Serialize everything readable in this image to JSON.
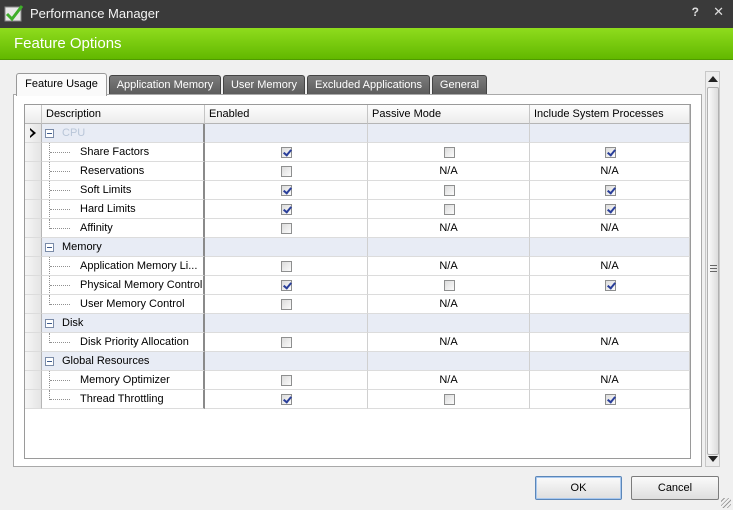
{
  "window": {
    "title": "Performance Manager",
    "help_glyph": "?",
    "close_glyph": "✕"
  },
  "banner": {
    "title": "Feature Options"
  },
  "tabs": [
    {
      "label": "Feature Usage",
      "active": true
    },
    {
      "label": "Application Memory",
      "active": false
    },
    {
      "label": "User Memory",
      "active": false
    },
    {
      "label": "Excluded Applications",
      "active": false
    },
    {
      "label": "General",
      "active": false
    }
  ],
  "grid": {
    "columns": [
      "Description",
      "Enabled",
      "Passive Mode",
      "Include System Processes"
    ],
    "groups": [
      {
        "label": "CPU",
        "rows": [
          {
            "label": "Share Factors",
            "enabled": true,
            "passive": false,
            "system": true
          },
          {
            "label": "Reservations",
            "enabled": false,
            "passive": "N/A",
            "system": "N/A"
          },
          {
            "label": "Soft Limits",
            "enabled": true,
            "passive": false,
            "system": true
          },
          {
            "label": "Hard Limits",
            "enabled": true,
            "passive": false,
            "system": true
          },
          {
            "label": "Affinity",
            "enabled": false,
            "passive": "N/A",
            "system": "N/A"
          }
        ]
      },
      {
        "label": "Memory",
        "rows": [
          {
            "label": "Application Memory Li...",
            "enabled": false,
            "passive": "N/A",
            "system": "N/A"
          },
          {
            "label": "Physical Memory Control",
            "enabled": true,
            "passive": false,
            "system": true
          },
          {
            "label": "User Memory Control",
            "enabled": false,
            "passive": "N/A",
            "system": ""
          }
        ]
      },
      {
        "label": "Disk",
        "rows": [
          {
            "label": "Disk Priority Allocation",
            "enabled": false,
            "passive": "N/A",
            "system": "N/A"
          }
        ]
      },
      {
        "label": "Global Resources",
        "rows": [
          {
            "label": "Memory Optimizer",
            "enabled": false,
            "passive": "N/A",
            "system": "N/A"
          },
          {
            "label": "Thread Throttling",
            "enabled": true,
            "passive": false,
            "system": true
          }
        ]
      }
    ]
  },
  "buttons": {
    "ok": "OK",
    "cancel": "Cancel"
  },
  "colors": {
    "banner_green": "#7ccf12",
    "titlebar": "#3a3a3a",
    "group_row": "#e8ecf5",
    "check": "#2a3f9a"
  }
}
